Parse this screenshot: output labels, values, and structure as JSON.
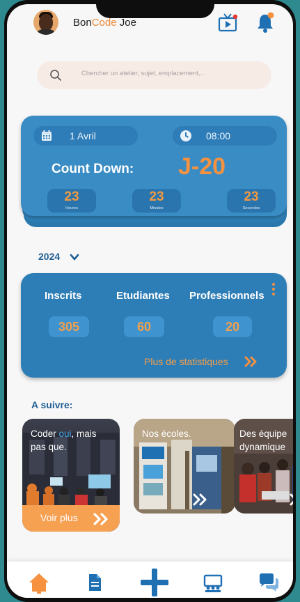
{
  "header": {
    "user_prefix": "Bon",
    "user_accent": "Code",
    "user_suffix": " Joe",
    "accent_color": "#f08a35"
  },
  "search": {
    "placeholder": "Chercher un atelier, sujet, emplacement,..."
  },
  "countdown": {
    "date": "1 Avril",
    "time": "08:00",
    "title": "Count Down:",
    "value": "J-20",
    "units": [
      {
        "value": "23",
        "label": "Heures"
      },
      {
        "value": "23",
        "label": "Minutes"
      },
      {
        "value": "23",
        "label": "Secondes"
      }
    ]
  },
  "year_selector": {
    "year": "2024"
  },
  "stats": {
    "items": [
      {
        "label": "Inscrits",
        "value": "305"
      },
      {
        "label": "Etudiantes",
        "value": "60"
      },
      {
        "label": "Professionnels",
        "value": "20"
      }
    ],
    "more_link": "Plus de statistiques"
  },
  "upcoming": {
    "title": "A suivre:",
    "cards": [
      {
        "line1_a": "Coder ",
        "line1_hl": "oui",
        "line1_b": ", mais",
        "line2": "pas que.",
        "button": "Voir plus"
      },
      {
        "text": "Nos écoles."
      },
      {
        "line1": "Des équipe",
        "line2": "dynamique"
      }
    ]
  },
  "colors": {
    "primary_blue": "#3a8cc4",
    "accent_orange": "#f5913f",
    "bell_blue": "#1f6fb3"
  },
  "icons": [
    "tv-icon",
    "bell-icon",
    "search-icon",
    "calendar-icon",
    "clock-icon",
    "chevron-down-icon",
    "kebab-icon",
    "double-chevron-icon",
    "home-icon",
    "document-icon",
    "plus-icon",
    "presentation-icon",
    "chat-icon"
  ]
}
